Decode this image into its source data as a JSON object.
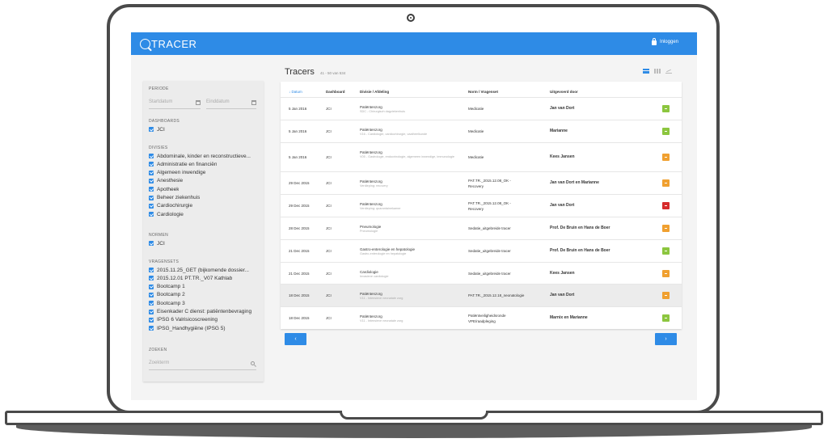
{
  "app": {
    "logo_text": "TRACER",
    "login_label": "Inloggen"
  },
  "sidebar": {
    "periode_label": "PERIODE",
    "start_placeholder": "Startdatum",
    "end_placeholder": "Einddatum",
    "dashboards_label": "DASHBOARDS",
    "dashboards": [
      "JCI"
    ],
    "divisies_label": "DIVISIES",
    "divisies": [
      "Abdominale, kinder en reconstructieve...",
      "Administratie en financiën",
      "Algemeen inwendige",
      "Anesthesie",
      "Apotheek",
      "Beheer ziekenhuis",
      "Cardiochirurgie",
      "Cardiologie"
    ],
    "normen_label": "NORMEN",
    "normen": [
      "JCI"
    ],
    "vragensets_label": "VRAGENSETS",
    "vragensets": [
      "2015.11.25_GET (bijkomende dossier...",
      "2015.12.01 PT.TR._V07 Kathlab",
      "Bootcamp 1",
      "Bootcamp 2",
      "Bootcamp 3",
      "Eisenkader C dienst: patiëntenbevraging",
      "IPSG 6 Valrisicoscreening",
      "IPSG_Handhygiëne (IPSG 5)"
    ],
    "zoeken_label": "ZOEKEN",
    "search_placeholder": "Zoekterm"
  },
  "main": {
    "title": "Tracers",
    "range_text": "41 - 50 van 534",
    "columns": [
      "Datum",
      "Dashboard",
      "Divisie / Afdeling",
      "Norm / Vragenset",
      "Uitgevoerd door"
    ],
    "rows": [
      {
        "date": "5 Jan 2016",
        "dashboard": "JCI",
        "division": "Patiëntenzorg",
        "sub": "SDC - Chirurgisch dagziekenhuis",
        "norm": "Medicatie",
        "norm2": "",
        "by": "Jan van Dort",
        "status_color": "#8cc63f"
      },
      {
        "date": "5 Jan 2016",
        "dashboard": "JCI",
        "division": "Patiëntenzorg",
        "sub": "V16 - Cardiologie, cardiochirurgie, vaatheelkunde",
        "norm": "Medicatie",
        "norm2": "",
        "by": "Marianne",
        "status_color": "#8cc63f"
      },
      {
        "date": "5 Jan 2016",
        "dashboard": "JCI",
        "division": "Patiëntenzorg",
        "sub": "V05 - Gastrologie, endocrinologie, algemeen inwendige, immunologie",
        "norm": "Medicatie",
        "norm2": "",
        "by": "Kees Jansen",
        "status_color": "#f0a030"
      },
      {
        "date": "29 Dec 2015",
        "dashboard": "JCI",
        "division": "Patiëntenzorg",
        "sub": "Verdieping: recovery",
        "norm": "PAT.TR._2015.12.08_OK -",
        "norm2": "Recovery",
        "by": "Jan van Dort en Marianne",
        "status_color": "#f0a030"
      },
      {
        "date": "29 Dec 2015",
        "dashboard": "JCI",
        "division": "Patiëntenzorg",
        "sub": "Verdieping: quarantainekamer",
        "norm": "PAT.TR._2015.12.08_OK -",
        "norm2": "Recovery",
        "by": "Jan van Dort",
        "status_color": "#d62b2b"
      },
      {
        "date": "28 Dec 2015",
        "dashboard": "JCI",
        "division": "Pneumologie",
        "sub": "Pneumologie",
        "norm": "Sedatie_uitgebreide tracer",
        "norm2": "",
        "by": "Prof. De Bruin en Hans de Boer",
        "status_color": "#f0a030"
      },
      {
        "date": "21 Dec 2015",
        "dashboard": "JCI",
        "division": "Gastro-enterologie en hepatologie",
        "sub": "Gastro-enterologie en hepatologie",
        "norm": "Sedatie_uitgebreide tracer",
        "norm2": "",
        "by": "Prof. De Bruin en Hans de Boer",
        "status_color": "#8cc63f"
      },
      {
        "date": "21 Dec 2015",
        "dashboard": "JCI",
        "division": "Cardiologie",
        "sub": "Invasieve cardiologie",
        "norm": "Sedatie_uitgebreide tracer",
        "norm2": "",
        "by": "Kees Jansen",
        "status_color": "#f0a030"
      },
      {
        "date": "18 Dec 2015",
        "dashboard": "JCI",
        "division": "Patiëntenzorg",
        "sub": "V11 - Intensieve neonatale zorg",
        "norm": "PAT.TR._2015.12.18_neonatologie",
        "norm2": "",
        "by": "Jan van Dort",
        "status_color": "#f0a030"
      },
      {
        "date": "18 Dec 2015",
        "dashboard": "JCI",
        "division": "Patiëntenzorg",
        "sub": "V11 - Intensieve neonatale zorg",
        "norm": "Patiëntveiligheidsronde",
        "norm2": "VPE/raadpleging",
        "by": "Marnix  en Marianne",
        "status_color": "#8cc63f"
      }
    ],
    "prev_label": "‹",
    "next_label": "›"
  }
}
